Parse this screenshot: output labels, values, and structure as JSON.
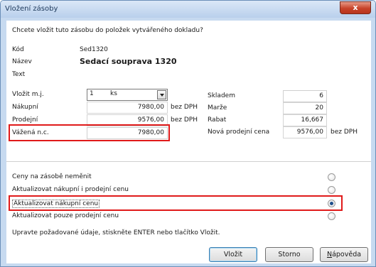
{
  "window": {
    "title": "Vložení zásoby",
    "close_label": "x"
  },
  "prompt": "Chcete vložit tuto zásobu do položek vytvářeného dokladu?",
  "info": {
    "kod_label": "Kód",
    "kod_value": "Sed1320",
    "nazev_label": "Název",
    "nazev_value": "Sedací souprava 1320",
    "text_label": "Text"
  },
  "left": {
    "vlozit_label": "Vložit m.j.",
    "qty": "1",
    "unit": "ks",
    "nakupni_label": "Nákupní",
    "nakupni_value": "7980,00",
    "nakupni_suffix": "bez DPH",
    "prodejni_label": "Prodejní",
    "prodejni_value": "9576,00",
    "prodejni_suffix": "bez DPH",
    "vazena_label": "Vážená n.c.",
    "vazena_value": "7980,00"
  },
  "right": {
    "skladem_label": "Skladem",
    "skladem_value": "6",
    "marze_label": "Marže",
    "marze_value": "20",
    "rabat_label": "Rabat",
    "rabat_value": "16,667",
    "nova_label": "Nová prodejní cena",
    "nova_value": "9576,00",
    "nova_suffix": "bez DPH"
  },
  "options": [
    {
      "label": "Ceny na zásobě neměnit",
      "selected": false
    },
    {
      "label": "Aktualizovat nákupní i prodejní cenu",
      "selected": false
    },
    {
      "label": "Aktualizovat nákupní cenu",
      "selected": true
    },
    {
      "label": "Aktualizovat pouze prodejní cenu",
      "selected": false
    }
  ],
  "hint": "Upravte požadované údaje, stiskněte ENTER nebo tlačítko Vložit.",
  "buttons": {
    "vlozit": "Vložit",
    "storno": "Storno",
    "napoveda_first": "N",
    "napoveda_rest": "ápověda"
  },
  "colors": {
    "highlight": "#e01a1a",
    "titlebar": "#c7daf0",
    "close": "#c7432a"
  }
}
